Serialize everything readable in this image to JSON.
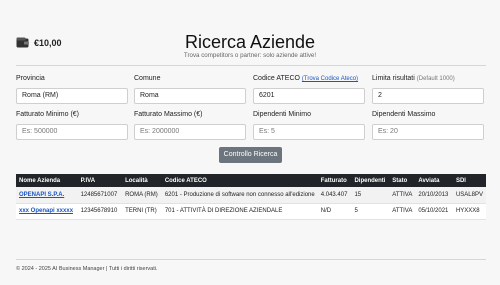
{
  "wallet": {
    "amount": "€10,00",
    "icon": "wallet-icon"
  },
  "header": {
    "title": "Ricerca Aziende",
    "subtitle": "Trova competitors o partner: solo aziende attive!"
  },
  "filters": {
    "provincia": {
      "label": "Provincia",
      "value": "Roma (RM)"
    },
    "comune": {
      "label": "Comune",
      "value": "Roma"
    },
    "ateco": {
      "label": "Codice ATECO",
      "link": "(Trova Codice Ateco)",
      "value": "6201"
    },
    "limite": {
      "label": "Limita risultati",
      "hint": "(Default 1000)",
      "value": "2"
    },
    "fatt_min": {
      "label": "Fatturato Minimo (€)",
      "placeholder": "Es: 500000"
    },
    "fatt_max": {
      "label": "Fatturato Massimo (€)",
      "placeholder": "Es: 2000000"
    },
    "dip_min": {
      "label": "Dipendenti Minimo",
      "placeholder": "Es: 5"
    },
    "dip_max": {
      "label": "Dipendenti Massimo",
      "placeholder": "Es: 20"
    }
  },
  "submit_label": "Controllo Ricerca",
  "table": {
    "headers": [
      "Nome Azienda",
      "P.IVA",
      "Località",
      "Codice ATECO",
      "Fatturato",
      "Dipendenti",
      "Stato",
      "Avviata",
      "SDI"
    ],
    "rows": [
      [
        "OPENAPI S.P.A.",
        "12485671007",
        "ROMA (RM)",
        "6201 - Produzione di software non connesso all'edizione",
        "4.043.407",
        "15",
        "ATTIVA",
        "20/10/2013",
        "USAL8PV"
      ],
      [
        "xxx Openapi xxxxx",
        "12345678910",
        "TERNI (TR)",
        "701 - ATTIVITÀ DI DIREZIONE AZIENDALE",
        "N/D",
        "5",
        "ATTIVA",
        "05/10/2021",
        "HYXXX8"
      ]
    ]
  },
  "footer": "© 2024 - 2025 AI Business Manager | Tutti i diritti riservati."
}
